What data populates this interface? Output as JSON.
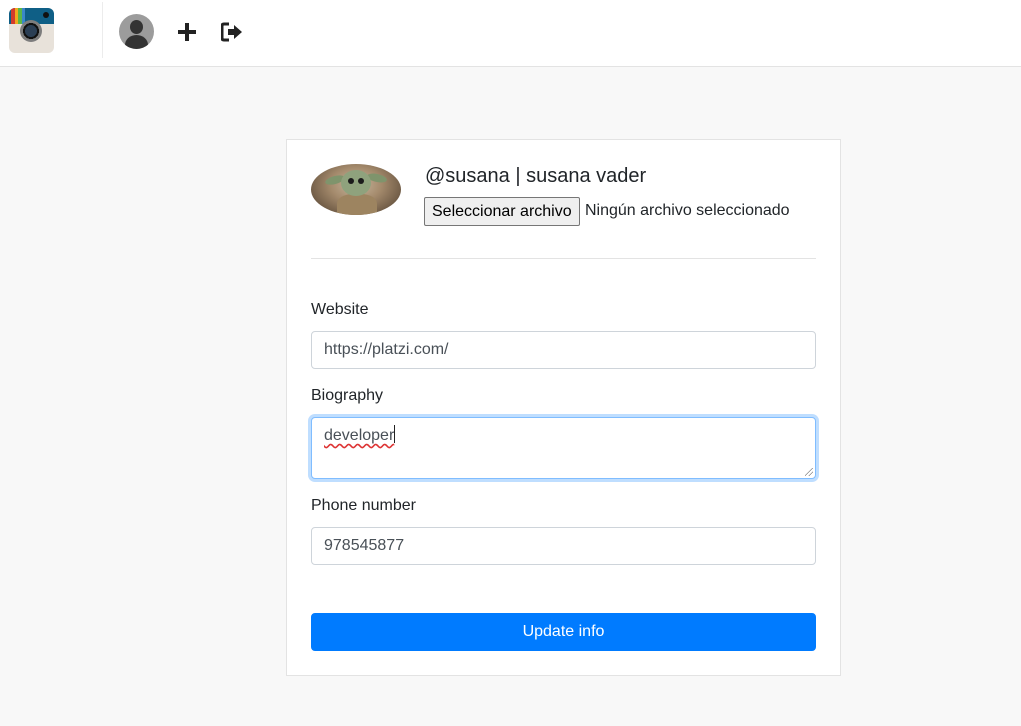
{
  "nav": {
    "logo_icon": "camera-app-logo",
    "avatar_icon": "user-avatar",
    "new_post_icon": "plus-icon",
    "logout_icon": "sign-out-icon"
  },
  "profile": {
    "handle_line": "@susana | susana vader",
    "file_button_label": "Seleccionar archivo",
    "file_status": "Ningún archivo seleccionado"
  },
  "form": {
    "website_label": "Website",
    "website_value": "https://platzi.com/",
    "biography_label": "Biography",
    "biography_value": "developer",
    "phone_label": "Phone number",
    "phone_value": "978545877",
    "submit_label": "Update info"
  },
  "colors": {
    "primary": "#007bff",
    "page_background": "#f8f8f8",
    "focus_border": "#80bdff"
  }
}
